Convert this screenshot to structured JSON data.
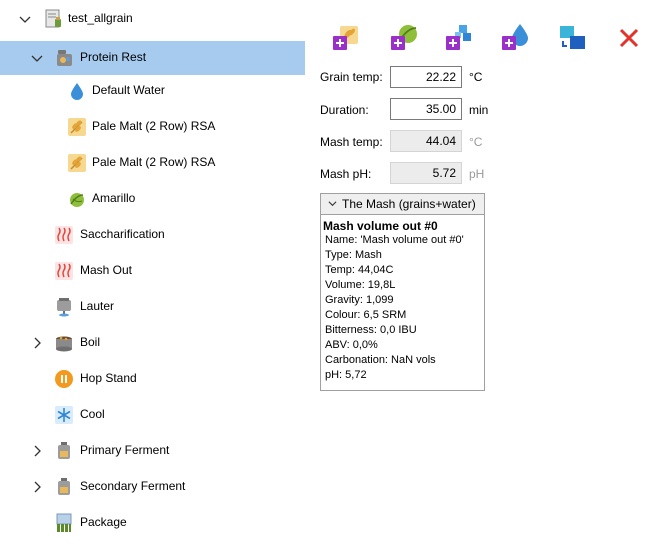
{
  "tree": {
    "items": [
      {
        "label": "test_allgrain",
        "expander": "expanded",
        "icon": "recipe-icon"
      },
      {
        "label": "Protein Rest",
        "expander": "expanded",
        "icon": "mash-step-icon",
        "selected": true
      },
      {
        "label": "Default Water",
        "icon": "water-drop-icon"
      },
      {
        "label": "Pale Malt (2 Row) RSA",
        "icon": "grain-icon"
      },
      {
        "label": "Pale Malt (2 Row) RSA",
        "icon": "grain-icon"
      },
      {
        "label": "Amarillo",
        "icon": "hop-icon"
      },
      {
        "label": "Saccharification",
        "icon": "heat-icon"
      },
      {
        "label": "Mash Out",
        "icon": "heat-icon"
      },
      {
        "label": "Lauter",
        "icon": "lauter-icon"
      },
      {
        "label": "Boil",
        "expander": "collapsed",
        "icon": "boil-pot-icon"
      },
      {
        "label": "Hop Stand",
        "icon": "pause-icon"
      },
      {
        "label": "Cool",
        "icon": "snowflake-icon"
      },
      {
        "label": "Primary Ferment",
        "expander": "collapsed",
        "icon": "fermenter-icon"
      },
      {
        "label": "Secondary Ferment",
        "expander": "collapsed",
        "icon": "fermenter-icon"
      },
      {
        "label": "Package",
        "icon": "package-icon"
      }
    ]
  },
  "toolbar": {
    "buttons": [
      {
        "icon": "add-grain-icon"
      },
      {
        "icon": "add-hop-icon"
      },
      {
        "icon": "add-misc-icon"
      },
      {
        "icon": "add-water-icon"
      },
      {
        "icon": "move-icon"
      },
      {
        "icon": "close-icon",
        "color": "#e0342c"
      }
    ]
  },
  "form": {
    "grain_temp": {
      "label": "Grain temp:",
      "value": "22.22",
      "unit": "°C"
    },
    "duration": {
      "label": "Duration:",
      "value": "35.00",
      "unit": "min"
    },
    "mash_temp": {
      "label": "Mash temp:",
      "value": "44.04",
      "unit": "°C"
    },
    "mash_ph": {
      "label": "Mash pH:",
      "value": "5.72",
      "unit": "pH"
    }
  },
  "mash": {
    "header": "The Mash (grains+water)",
    "title": "Mash volume out #0",
    "lines": [
      "Name: 'Mash volume out #0'",
      "Type: Mash",
      "Temp: 44,04C",
      "Volume: 19,8L",
      "Gravity: 1,099",
      "Colour: 6,5 SRM",
      "Bitterness: 0,0 IBU",
      "ABV: 0,0%",
      "Carbonation: NaN vols",
      "pH: 5,72"
    ]
  },
  "colors": {
    "selection": "#a6cbee",
    "accent_purple": "#9b2fc9",
    "close_red": "#e0342c"
  }
}
